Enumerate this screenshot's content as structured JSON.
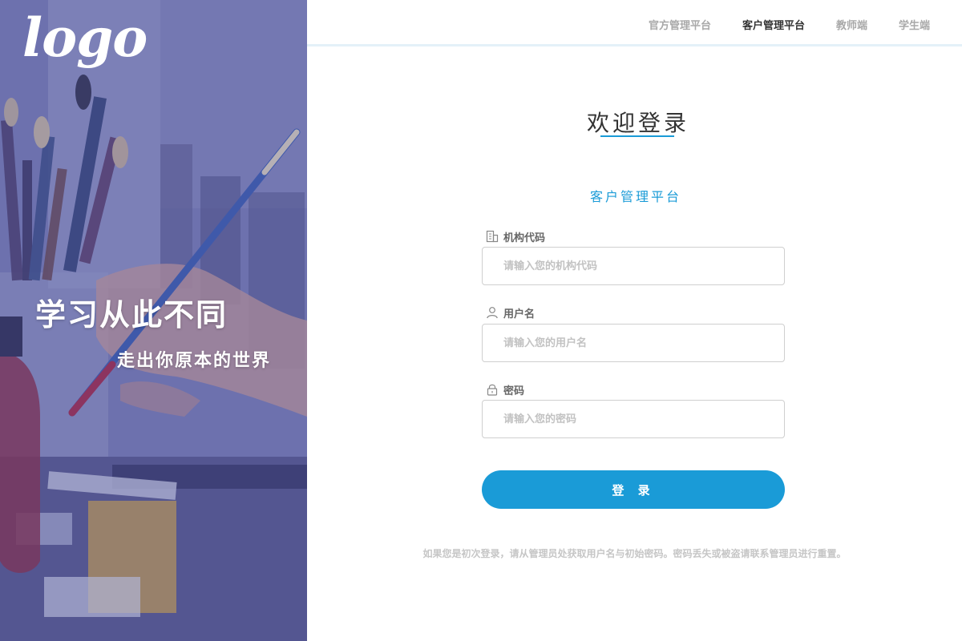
{
  "hero": {
    "logo": "logo",
    "title": "学习从此不同",
    "subtitle": "走出你原本的世界"
  },
  "nav": {
    "items": [
      {
        "label": "官方管理平台",
        "active": false
      },
      {
        "label": "客户管理平台",
        "active": true
      },
      {
        "label": "教师端",
        "active": false
      },
      {
        "label": "学生端",
        "active": false
      }
    ]
  },
  "login": {
    "welcome": "欢迎登录",
    "platform": "客户管理平台",
    "fields": [
      {
        "label": "机构代码",
        "placeholder": "请输入您的机构代码",
        "icon": "building-icon"
      },
      {
        "label": "用户名",
        "placeholder": "请输入您的用户名",
        "icon": "user-icon"
      },
      {
        "label": "密码",
        "placeholder": "请输入您的密码",
        "icon": "lock-icon"
      }
    ],
    "button": "登 录",
    "hint": "如果您是初次登录，请从管理员处获取用户名与初始密码。密码丢失或被盗请联系管理员进行重置。"
  },
  "colors": {
    "accent": "#1a9bd7",
    "hero_overlay": "#5a5e97"
  }
}
